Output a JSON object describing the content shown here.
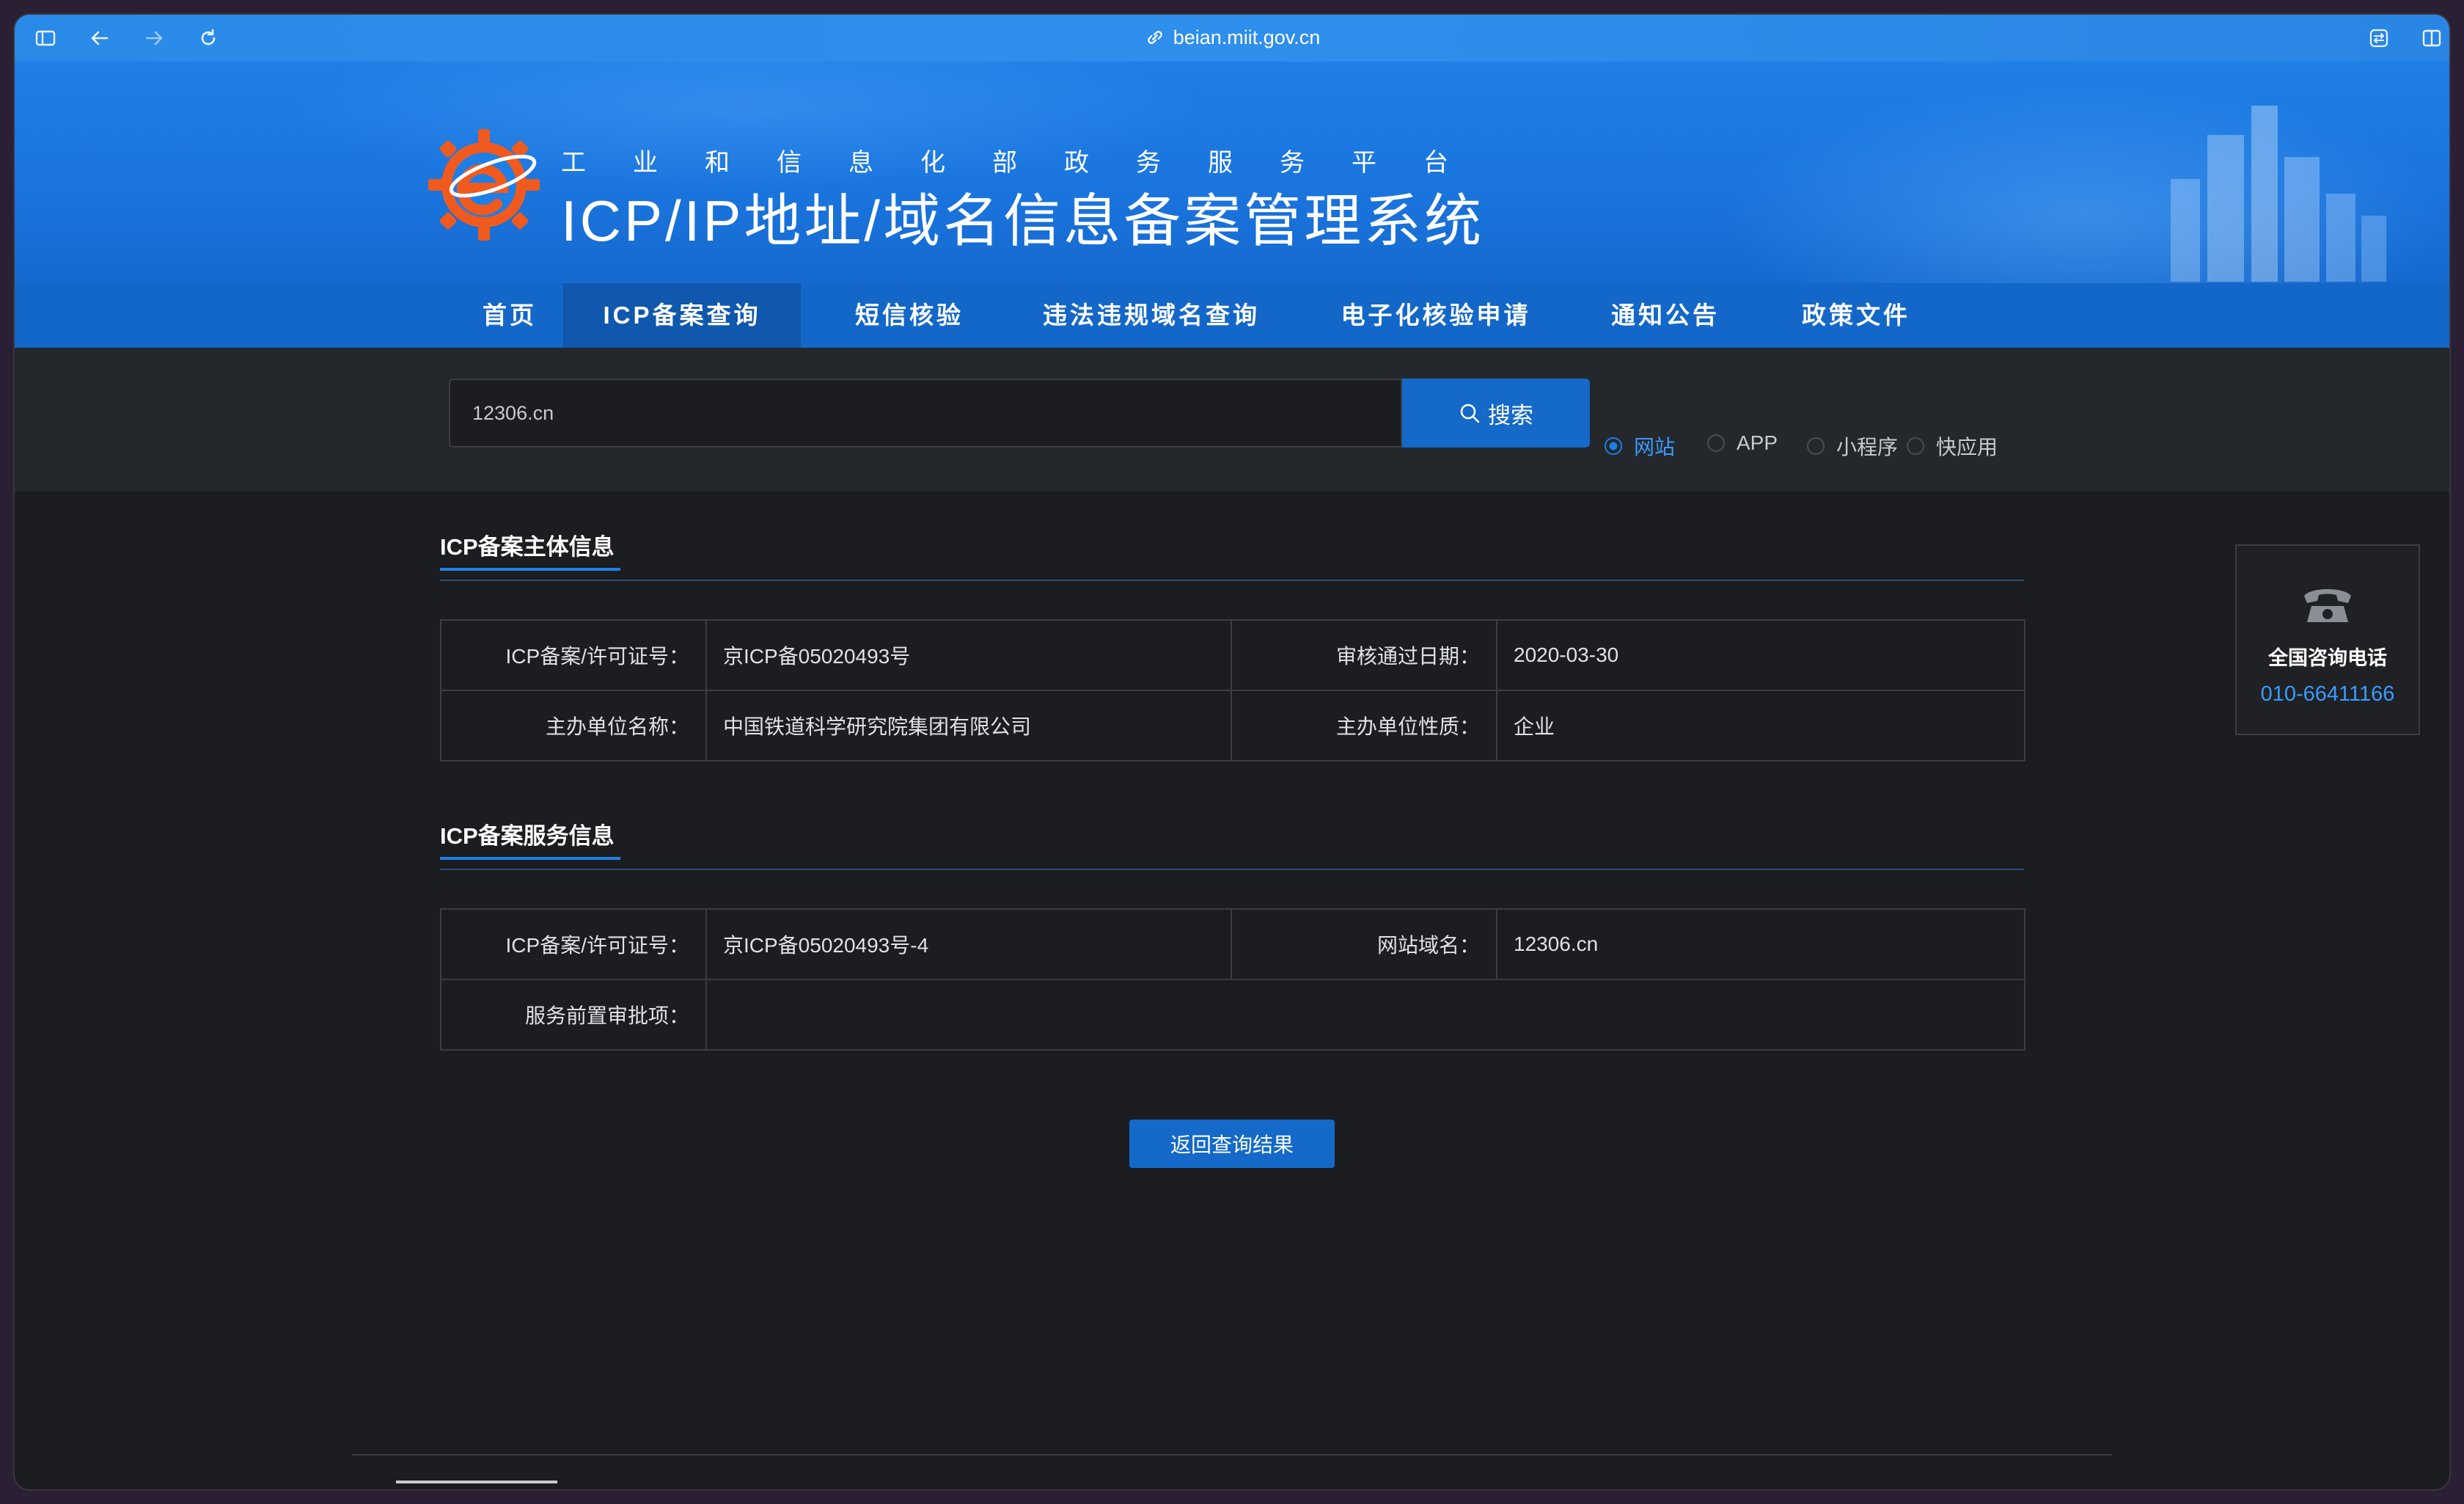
{
  "browser": {
    "url": "beian.miit.gov.cn"
  },
  "header": {
    "subtitle": "工业和信息化部政务服务平台",
    "title": "ICP/IP地址/域名信息备案管理系统"
  },
  "nav": {
    "items": [
      {
        "label": "首页"
      },
      {
        "label": "ICP备案查询"
      },
      {
        "label": "短信核验"
      },
      {
        "label": "违法违规域名查询"
      },
      {
        "label": "电子化核验申请"
      },
      {
        "label": "通知公告"
      },
      {
        "label": "政策文件"
      }
    ],
    "active": "ICP备案查询"
  },
  "search": {
    "value": "12306.cn",
    "button_label": "搜索",
    "options": [
      {
        "label": "网站",
        "selected": true
      },
      {
        "label": "APP",
        "selected": false
      },
      {
        "label": "小程序",
        "selected": false
      },
      {
        "label": "快应用",
        "selected": false
      }
    ]
  },
  "subject_info": {
    "title": "ICP备案主体信息",
    "rows": [
      {
        "k1": "ICP备案/许可证号：",
        "v1": "京ICP备05020493号",
        "k2": "审核通过日期：",
        "v2": "2020-03-30"
      },
      {
        "k1": "主办单位名称：",
        "v1": "中国铁道科学研究院集团有限公司",
        "k2": "主办单位性质：",
        "v2": "企业"
      }
    ]
  },
  "service_info": {
    "title": "ICP备案服务信息",
    "rows": [
      {
        "k1": "ICP备案/许可证号：",
        "v1": "京ICP备05020493号-4",
        "k2": "网站域名：",
        "v2": "12306.cn"
      },
      {
        "k1": "服务前置审批项：",
        "v1": ""
      }
    ]
  },
  "back_button": "返回查询结果",
  "contact": {
    "label": "全国咨询电话",
    "phone": "010-66411166"
  },
  "colors": {
    "brand_blue": "#1e7fe6",
    "nav_blue": "#1367c8",
    "button_blue": "#1469c9",
    "link_blue": "#3b9bff",
    "logo_orange": "#f05a1e"
  }
}
